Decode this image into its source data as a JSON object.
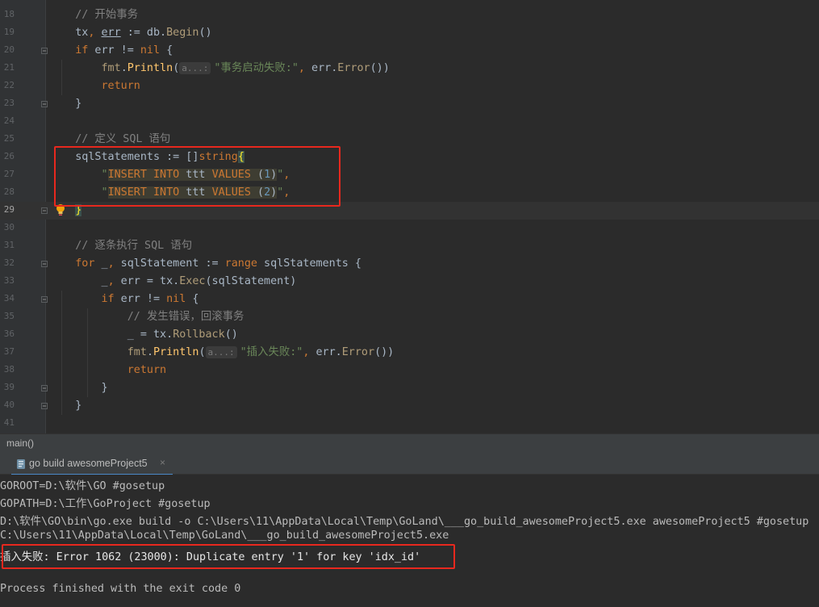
{
  "editor": {
    "lines": [
      {
        "num": "18",
        "text": "    // 开始事务"
      },
      {
        "num": "19",
        "text": "    tx, err := db.Begin()"
      },
      {
        "num": "20",
        "text": "    if err != nil {"
      },
      {
        "num": "21",
        "text": "        fmt.Println( a...: \"事务启动失败:\", err.Error())",
        "hint": "a...:"
      },
      {
        "num": "22",
        "text": "        return"
      },
      {
        "num": "23",
        "text": "    }"
      },
      {
        "num": "24",
        "text": ""
      },
      {
        "num": "25",
        "text": "    // 定义 SQL 语句"
      },
      {
        "num": "26",
        "text": "    sqlStatements := []string{"
      },
      {
        "num": "27",
        "text": "        \"INSERT INTO ttt VALUES (1)\","
      },
      {
        "num": "28",
        "text": "        \"INSERT INTO ttt VALUES (2)\","
      },
      {
        "num": "29",
        "text": "    }"
      },
      {
        "num": "30",
        "text": ""
      },
      {
        "num": "31",
        "text": "    // 逐条执行 SQL 语句"
      },
      {
        "num": "32",
        "text": "    for _, sqlStatement := range sqlStatements {"
      },
      {
        "num": "33",
        "text": "        _, err = tx.Exec(sqlStatement)"
      },
      {
        "num": "34",
        "text": "        if err != nil {"
      },
      {
        "num": "35",
        "text": "            // 发生错误，回滚事务"
      },
      {
        "num": "36",
        "text": "            _ = tx.Rollback()"
      },
      {
        "num": "37",
        "text": "            fmt.Println( a...: \"插入失败:\", err.Error())",
        "hint": "a...:"
      },
      {
        "num": "38",
        "text": "            return"
      },
      {
        "num": "39",
        "text": "        }"
      },
      {
        "num": "40",
        "text": "    }"
      },
      {
        "num": "41",
        "text": ""
      }
    ],
    "current_line": "29"
  },
  "breadcrumb": {
    "label": "main()"
  },
  "run_panel": {
    "tab_label": "go build awesomeProject5",
    "close_glyph": "×"
  },
  "console": {
    "lines": [
      "GOROOT=D:\\软件\\GO #gosetup",
      "GOPATH=D:\\工作\\GoProject #gosetup",
      "D:\\软件\\GO\\bin\\go.exe build -o C:\\Users\\11\\AppData\\Local\\Temp\\GoLand\\___go_build_awesomeProject5.exe awesomeProject5 #gosetup",
      "C:\\Users\\11\\AppData\\Local\\Temp\\GoLand\\___go_build_awesomeProject5.exe",
      "插入失败: Error 1062 (23000): Duplicate entry '1' for key 'idx_id'",
      "",
      "Process finished with the exit code 0"
    ]
  },
  "colors": {
    "background": "#2b2b2b",
    "keyword": "#cc7832",
    "string": "#6a8759",
    "number": "#6897bb",
    "comment": "#808080",
    "highlight_box": "#e8281e"
  }
}
